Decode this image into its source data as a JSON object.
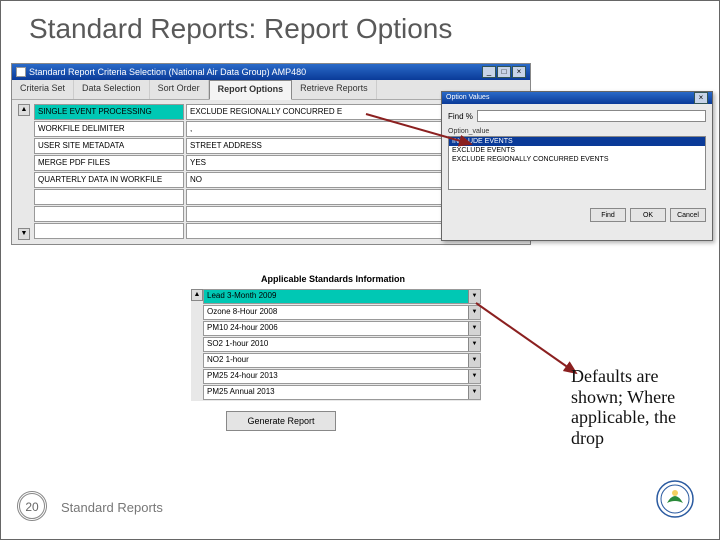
{
  "slide": {
    "title": "Standard Reports: Report Options",
    "page_number": "20",
    "footer_text": "Standard Reports",
    "callout_text": "Defaults are shown; Where applicable, the drop"
  },
  "window": {
    "title": "Standard Report Criteria Selection (National Air Data Group) AMP480",
    "tabs": [
      "Criteria Set",
      "Data Selection",
      "Sort Order",
      "Report Options",
      "Retrieve Reports"
    ],
    "active_tab_index": 3,
    "options": [
      {
        "label": "SINGLE EVENT PROCESSING",
        "value": "EXCLUDE REGIONALLY CONCURRED E",
        "highlighted": true
      },
      {
        "label": "WORKFILE DELIMITER",
        "value": ",",
        "highlighted": false
      },
      {
        "label": "USER SITE METADATA",
        "value": "STREET ADDRESS",
        "highlighted": false
      },
      {
        "label": "MERGE PDF FILES",
        "value": "YES",
        "highlighted": false
      },
      {
        "label": "QUARTERLY DATA IN WORKFILE",
        "value": "NO",
        "highlighted": false
      },
      {
        "label": "",
        "value": "",
        "highlighted": false
      },
      {
        "label": "",
        "value": "",
        "highlighted": false
      },
      {
        "label": "",
        "value": "",
        "highlighted": false
      }
    ],
    "applicable_label": "Applicable Standards Information",
    "standards": [
      {
        "label": "Lead 3-Month 2009",
        "highlighted": true
      },
      {
        "label": "Ozone 8-Hour 2008",
        "highlighted": false
      },
      {
        "label": "PM10 24-hour 2006",
        "highlighted": false
      },
      {
        "label": "SO2 1-hour 2010",
        "highlighted": false
      },
      {
        "label": "NO2 1-hour",
        "highlighted": false
      },
      {
        "label": "PM25 24-hour 2013",
        "highlighted": false
      },
      {
        "label": "PM25 Annual 2013",
        "highlighted": false
      }
    ],
    "generate_label": "Generate Report"
  },
  "popup": {
    "title": "Option Values",
    "find_label": "Find %",
    "column_header": "Option_value",
    "items": [
      "INCLUDE EVENTS",
      "EXCLUDE EVENTS",
      "EXCLUDE REGIONALLY CONCURRED EVENTS"
    ],
    "selected_index": 0,
    "buttons": {
      "find": "Find",
      "ok": "OK",
      "cancel": "Cancel"
    }
  },
  "icons": {
    "up": "▲",
    "down": "▼",
    "min": "_",
    "max": "□",
    "close": "×"
  }
}
